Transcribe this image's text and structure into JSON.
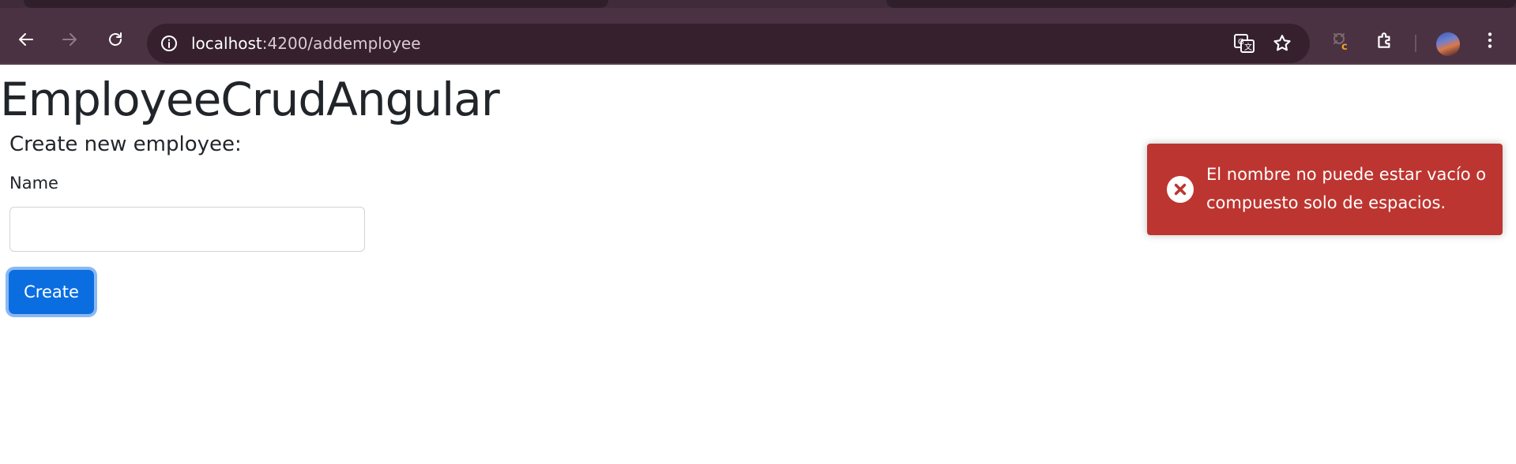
{
  "browser": {
    "url_host": "localhost",
    "url_path": ":4200/addemployee",
    "icons": {
      "back": "arrow-left-icon",
      "forward": "arrow-right-icon",
      "reload": "reload-icon",
      "site_info": "info-icon",
      "translate": "translate-icon",
      "bookmark": "star-icon",
      "extension": "extension-c-icon",
      "extensions_menu": "puzzle-icon",
      "profile": "avatar",
      "menu": "kebab-menu-icon"
    },
    "colors": {
      "chrome_bg": "#4a3242",
      "omnibox_bg": "#36202e"
    }
  },
  "app": {
    "title": "EmployeeCrudAngular"
  },
  "form": {
    "heading": "Create new employee:",
    "name_label": "Name",
    "name_value": "",
    "submit_label": "Create"
  },
  "toast": {
    "type": "error",
    "message": "El nombre no puede estar vacío o compuesto solo de espacios.",
    "icon": "error-x-icon",
    "color": "#bd3530"
  }
}
